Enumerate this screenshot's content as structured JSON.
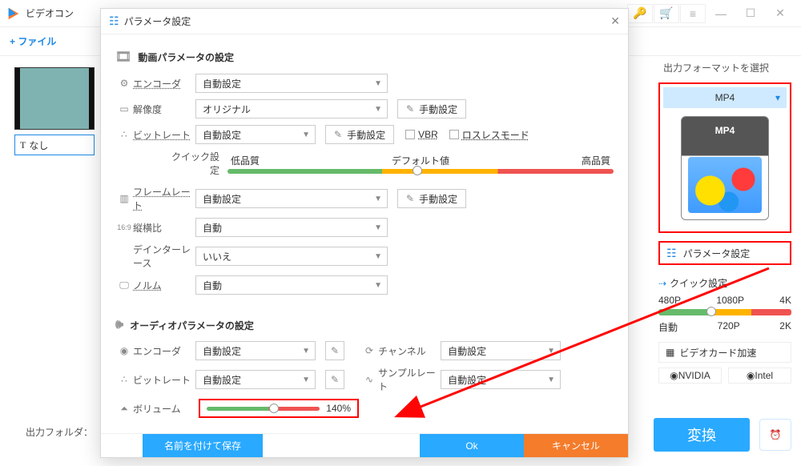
{
  "app": {
    "title": "ビデオコン",
    "add_file": "+ ファイル",
    "thumb_caption_prefix": "T",
    "thumb_caption": "なし",
    "out_folder_label": "出力フォルダ："
  },
  "top_icons": {
    "key": "🔑",
    "cart": "🛒",
    "menu": "≡",
    "min": "—",
    "max": "☐",
    "close": "✕"
  },
  "sidebar": {
    "title": "出力フォーマットを選択",
    "format_label": "MP4",
    "format_thumb_text": "MP4",
    "param_button": "パラメータ設定",
    "quick_title": "クイック設定",
    "quick_top_labels": [
      "480P",
      "1080P",
      "4K"
    ],
    "quick_bottom_labels": [
      "自動",
      "720P",
      "2K"
    ],
    "gpu_button": "ビデオカード加速",
    "gpu_chips": [
      "NVIDIA",
      "Intel"
    ],
    "convert": "変換"
  },
  "dialog": {
    "title": "パラメータ設定",
    "video_section": "動画パラメータの設定",
    "audio_section": "オーディオパラメータの設定",
    "labels": {
      "encoder": "エンコーダ",
      "resolution": "解像度",
      "bitrate": "ビットレート",
      "quick_setting": "クイック設定",
      "low_q": "低品質",
      "default_v": "デフォルト値",
      "high_q": "高品質",
      "framerate": "フレームレート",
      "aspect": "縦横比",
      "deinterlace": "デインターレース",
      "norm": "ノルム",
      "channel": "チャンネル",
      "samplerate": "サンプルレート",
      "volume": "ボリューム"
    },
    "values": {
      "auto_set": "自動設定",
      "original": "オリジナル",
      "auto": "自動",
      "no": "いいえ",
      "manual": "手動設定",
      "vbr": "VBR",
      "lossless": "ロスレスモード",
      "volume_pct": "140%"
    },
    "footer": {
      "save_as": "名前を付けて保存",
      "ok": "Ok",
      "cancel": "キャンセル"
    }
  }
}
